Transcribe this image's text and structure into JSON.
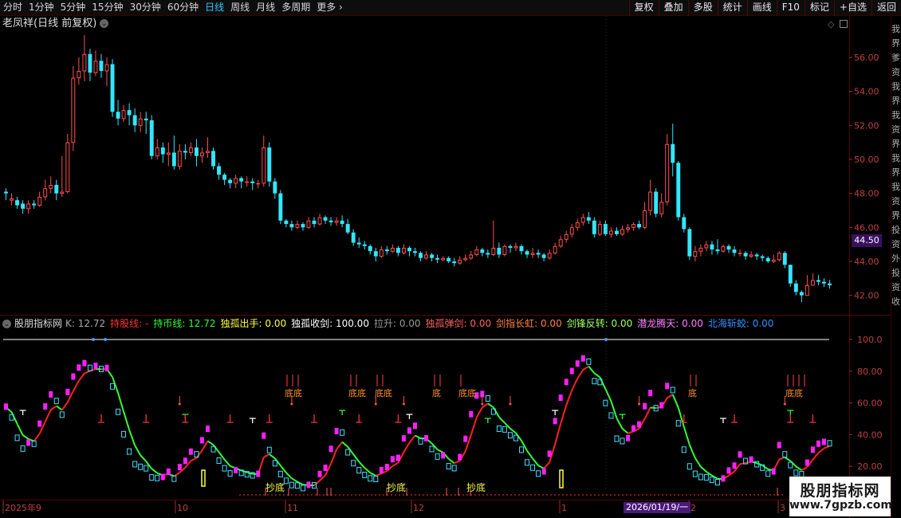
{
  "toolbar": {
    "periods": [
      "分时",
      "1分钟",
      "5分钟",
      "15分钟",
      "30分钟",
      "60分钟",
      "日线",
      "周线",
      "月线",
      "多周期",
      "更多"
    ],
    "active_period": "日线",
    "more_arrow": "›",
    "right_buttons": [
      "复权",
      "叠加",
      "多股",
      "统计",
      "画线",
      "F10",
      "标记",
      "+自选",
      "返回"
    ]
  },
  "main_panel": {
    "title": "老凤祥(日线 前复权)",
    "settings_icon": "chevron-down-circle",
    "diamond_icon": "◇",
    "current_price_tag": "44.50",
    "price_axis": [
      "56.00",
      "54.00",
      "52.00",
      "50.00",
      "48.00",
      "46.00",
      "44.00",
      "42.00"
    ]
  },
  "indicator_panel": {
    "name": "股朋指标网",
    "items": [
      {
        "label": "K: 12.72",
        "color": "#aaaaaa"
      },
      {
        "label": "持股线: -",
        "color": "#ff3030"
      },
      {
        "label": "持币线: 12.72",
        "color": "#30ff30"
      },
      {
        "label": "独孤出手: 0.00",
        "color": "#ffff40"
      },
      {
        "label": "独孤收剑: 100.00",
        "color": "#ffffff"
      },
      {
        "label": "拉升: 0.00",
        "color": "#999999"
      },
      {
        "label": "独孤弹剑: 0.00",
        "color": "#ff6060"
      },
      {
        "label": "剑指长虹: 0.00",
        "color": "#ff8040"
      },
      {
        "label": "剑锋反转: 0.00",
        "color": "#a0ff60"
      },
      {
        "label": "潜龙腾天: 0.00",
        "color": "#ff80ff"
      },
      {
        "label": "北海斩蛟: 0.00",
        "color": "#3090ff"
      }
    ],
    "axis": [
      "100.0",
      "80.00",
      "60.00",
      "40.00",
      "20.00"
    ],
    "signal_labels": [
      "抄底",
      "抄底",
      "抄底"
    ],
    "bottom_labels": [
      "底底",
      "底底",
      "底底",
      "底",
      "底底",
      "底",
      "底底"
    ]
  },
  "date_axis": {
    "labels": [
      "2025年9",
      "10",
      "11",
      "12",
      "1",
      "2",
      "3"
    ],
    "cursor_date": "2026/01/19/一"
  },
  "right_edge_glyphs": [
    "我",
    "界",
    "爹",
    "资",
    "我",
    "界",
    "我",
    "资",
    "界",
    "我",
    "界",
    "我",
    "资",
    "界",
    "投",
    "资",
    "外",
    "投",
    "资",
    "收"
  ],
  "watermark": {
    "line1": "股朋指标网",
    "line2": "www.7gpzb.com"
  },
  "colors": {
    "up": "#ff4d4d",
    "down": "#33e6ff",
    "white_line": "#ffffff",
    "green_line": "#30ff30",
    "red_line": "#ff2020",
    "magenta": "#ff20ff",
    "grid": "#5a0000"
  },
  "chart_data": {
    "type": "candlestick",
    "title": "老凤祥(日线 前复权)",
    "xlabel": "",
    "ylabel": "",
    "ylim": [
      41.0,
      57.5
    ],
    "candles": [
      [
        48.1,
        48.0,
        48.3,
        47.6
      ],
      [
        47.6,
        47.7,
        48.0,
        47.3
      ],
      [
        47.6,
        47.3,
        47.8,
        47.1
      ],
      [
        47.4,
        47.1,
        47.6,
        46.8
      ],
      [
        47.1,
        47.4,
        47.6,
        46.8
      ],
      [
        47.4,
        47.3,
        47.6,
        47.1
      ],
      [
        47.3,
        47.8,
        48.1,
        47.2
      ],
      [
        47.8,
        48.3,
        48.8,
        47.6
      ],
      [
        48.3,
        48.5,
        49.0,
        48.0
      ],
      [
        48.5,
        48.0,
        48.8,
        47.6
      ],
      [
        48.0,
        48.1,
        50.2,
        47.8
      ],
      [
        48.1,
        51.0,
        51.5,
        48.0
      ],
      [
        51.0,
        54.8,
        55.5,
        50.5
      ],
      [
        54.8,
        55.2,
        56.0,
        54.4
      ],
      [
        55.2,
        56.2,
        57.3,
        54.6
      ],
      [
        56.2,
        55.1,
        56.5,
        54.6
      ],
      [
        55.1,
        55.8,
        56.4,
        54.9
      ],
      [
        55.8,
        55.2,
        56.2,
        54.8
      ],
      [
        55.2,
        55.6,
        56.0,
        54.3
      ],
      [
        55.6,
        52.8,
        55.9,
        52.5
      ],
      [
        52.8,
        52.4,
        53.5,
        52.0
      ],
      [
        52.4,
        52.9,
        53.2,
        52.2
      ],
      [
        52.9,
        52.6,
        53.3,
        52.0
      ],
      [
        52.6,
        52.0,
        53.0,
        51.6
      ],
      [
        52.0,
        52.4,
        52.8,
        51.6
      ],
      [
        52.4,
        52.3,
        52.8,
        51.5
      ],
      [
        52.3,
        50.2,
        52.6,
        50.0
      ],
      [
        50.2,
        50.7,
        51.2,
        50.0
      ],
      [
        50.7,
        50.3,
        51.0,
        49.8
      ],
      [
        50.3,
        50.4,
        51.0,
        49.6
      ],
      [
        50.4,
        49.6,
        51.4,
        49.4
      ],
      [
        49.6,
        50.5,
        50.9,
        49.4
      ],
      [
        50.5,
        50.4,
        50.9,
        50.0
      ],
      [
        50.4,
        50.7,
        51.0,
        50.2
      ],
      [
        50.7,
        50.2,
        51.2,
        49.6
      ],
      [
        50.2,
        50.4,
        50.7,
        49.8
      ],
      [
        50.4,
        50.5,
        51.3,
        50.1
      ],
      [
        50.5,
        49.6,
        50.7,
        49.4
      ],
      [
        49.6,
        49.1,
        49.8,
        48.8
      ],
      [
        49.1,
        48.8,
        49.2,
        48.5
      ],
      [
        48.8,
        48.6,
        48.9,
        48.3
      ],
      [
        48.6,
        48.9,
        49.1,
        48.3
      ],
      [
        48.9,
        48.7,
        49.0,
        48.3
      ],
      [
        48.7,
        48.7,
        49.0,
        48.4
      ],
      [
        48.7,
        48.6,
        48.9,
        48.2
      ],
      [
        48.6,
        48.6,
        48.8,
        48.3
      ],
      [
        48.6,
        50.7,
        51.4,
        48.4
      ],
      [
        50.7,
        48.7,
        51.0,
        48.4
      ],
      [
        48.7,
        48.0,
        48.9,
        47.7
      ],
      [
        48.0,
        46.4,
        48.2,
        46.2
      ],
      [
        46.4,
        46.2,
        46.5,
        46.0
      ],
      [
        46.2,
        46.0,
        46.4,
        45.8
      ],
      [
        46.0,
        46.2,
        46.4,
        45.9
      ],
      [
        46.2,
        46.0,
        46.3,
        45.8
      ],
      [
        46.0,
        46.4,
        46.6,
        45.9
      ],
      [
        46.4,
        46.2,
        46.6,
        46.0
      ],
      [
        46.2,
        46.6,
        46.8,
        46.1
      ],
      [
        46.6,
        46.4,
        46.7,
        46.2
      ],
      [
        46.4,
        46.3,
        46.6,
        46.1
      ],
      [
        46.3,
        46.4,
        46.6,
        46.1
      ],
      [
        46.4,
        46.2,
        46.7,
        46.0
      ],
      [
        46.2,
        45.7,
        46.5,
        45.6
      ],
      [
        45.7,
        45.1,
        45.9,
        44.9
      ],
      [
        45.1,
        45.0,
        45.4,
        44.8
      ],
      [
        45.0,
        44.9,
        45.2,
        44.7
      ],
      [
        44.9,
        44.6,
        45.0,
        44.4
      ],
      [
        44.6,
        44.3,
        44.8,
        44.0
      ],
      [
        44.3,
        44.7,
        44.9,
        44.2
      ],
      [
        44.7,
        44.6,
        44.9,
        44.4
      ],
      [
        44.6,
        44.8,
        45.0,
        44.5
      ],
      [
        44.8,
        44.5,
        44.9,
        44.3
      ],
      [
        44.5,
        44.8,
        45.0,
        44.4
      ],
      [
        44.8,
        44.6,
        44.9,
        44.3
      ],
      [
        44.6,
        44.5,
        44.8,
        44.3
      ],
      [
        44.5,
        44.2,
        44.6,
        44.0
      ],
      [
        44.2,
        44.4,
        44.6,
        44.1
      ],
      [
        44.4,
        44.2,
        44.5,
        44.0
      ],
      [
        44.2,
        44.1,
        44.4,
        43.9
      ],
      [
        44.1,
        44.2,
        44.3,
        44.0
      ],
      [
        44.2,
        44.0,
        44.3,
        43.9
      ],
      [
        44.0,
        43.9,
        44.2,
        43.7
      ],
      [
        43.9,
        44.1,
        44.3,
        43.8
      ],
      [
        44.1,
        44.2,
        44.4,
        44.0
      ],
      [
        44.2,
        44.4,
        44.6,
        44.1
      ],
      [
        44.4,
        44.7,
        44.9,
        44.3
      ],
      [
        44.7,
        44.5,
        44.8,
        44.3
      ],
      [
        44.5,
        44.4,
        44.7,
        44.2
      ],
      [
        44.4,
        44.8,
        46.4,
        44.3
      ],
      [
        44.8,
        44.4,
        45.1,
        44.2
      ],
      [
        44.4,
        44.9,
        45.0,
        44.3
      ],
      [
        44.9,
        44.8,
        45.0,
        44.5
      ],
      [
        44.8,
        44.9,
        45.1,
        44.6
      ],
      [
        44.9,
        44.6,
        45.0,
        44.4
      ],
      [
        44.6,
        44.4,
        44.7,
        44.2
      ],
      [
        44.4,
        44.5,
        44.8,
        44.2
      ],
      [
        44.5,
        44.4,
        44.7,
        44.2
      ],
      [
        44.4,
        44.2,
        44.5,
        44.0
      ],
      [
        44.2,
        44.5,
        44.7,
        44.1
      ],
      [
        44.5,
        44.9,
        45.1,
        44.4
      ],
      [
        44.9,
        45.3,
        45.5,
        44.8
      ],
      [
        45.3,
        45.6,
        45.8,
        45.1
      ],
      [
        45.6,
        46.0,
        46.2,
        45.4
      ],
      [
        46.0,
        46.3,
        46.5,
        45.8
      ],
      [
        46.3,
        46.6,
        46.8,
        46.1
      ],
      [
        46.6,
        46.4,
        46.9,
        46.2
      ],
      [
        46.4,
        45.6,
        46.6,
        45.4
      ],
      [
        45.6,
        46.2,
        46.4,
        45.5
      ],
      [
        46.2,
        45.6,
        46.4,
        45.5
      ],
      [
        45.6,
        45.8,
        46.0,
        45.4
      ],
      [
        45.8,
        45.6,
        46.0,
        45.5
      ],
      [
        45.6,
        45.9,
        46.1,
        45.5
      ],
      [
        45.9,
        46.0,
        46.2,
        45.7
      ],
      [
        46.0,
        46.2,
        46.3,
        45.8
      ],
      [
        46.2,
        46.0,
        46.4,
        45.9
      ],
      [
        46.0,
        47.0,
        47.5,
        45.9
      ],
      [
        47.0,
        48.1,
        48.8,
        46.7
      ],
      [
        48.1,
        46.8,
        48.3,
        46.6
      ],
      [
        46.8,
        47.5,
        48.0,
        46.6
      ],
      [
        47.5,
        50.9,
        51.5,
        47.3
      ],
      [
        50.9,
        49.8,
        52.1,
        49.0
      ],
      [
        49.8,
        46.6,
        49.9,
        46.4
      ],
      [
        46.6,
        45.9,
        46.8,
        45.7
      ],
      [
        45.9,
        44.3,
        46.0,
        44.1
      ],
      [
        44.3,
        44.6,
        44.9,
        44.0
      ],
      [
        44.6,
        44.8,
        45.0,
        44.3
      ],
      [
        44.8,
        45.0,
        45.2,
        44.6
      ],
      [
        45.0,
        44.7,
        45.2,
        44.4
      ],
      [
        44.7,
        44.6,
        45.3,
        44.4
      ],
      [
        44.6,
        44.9,
        45.0,
        44.5
      ],
      [
        44.9,
        44.7,
        45.0,
        44.5
      ],
      [
        44.7,
        44.5,
        44.9,
        44.3
      ],
      [
        44.5,
        44.5,
        44.7,
        44.3
      ],
      [
        44.5,
        44.3,
        44.6,
        44.1
      ],
      [
        44.3,
        44.4,
        44.6,
        44.2
      ],
      [
        44.4,
        44.3,
        44.5,
        44.1
      ],
      [
        44.3,
        44.2,
        44.4,
        44.0
      ],
      [
        44.2,
        44.0,
        44.3,
        43.9
      ],
      [
        44.0,
        44.1,
        44.4,
        43.9
      ],
      [
        44.1,
        44.5,
        44.6,
        44.0
      ],
      [
        44.5,
        43.8,
        44.6,
        43.6
      ],
      [
        43.8,
        42.7,
        43.8,
        42.5
      ],
      [
        42.7,
        42.2,
        42.9,
        42.0
      ],
      [
        42.2,
        42.0,
        42.3,
        41.6
      ],
      [
        42.0,
        42.6,
        43.2,
        42.0
      ],
      [
        42.6,
        42.9,
        43.3,
        42.6
      ],
      [
        42.9,
        42.8,
        43.2,
        42.6
      ],
      [
        42.8,
        42.7,
        43.0,
        42.5
      ],
      [
        42.7,
        42.6,
        42.9,
        42.4
      ]
    ]
  }
}
